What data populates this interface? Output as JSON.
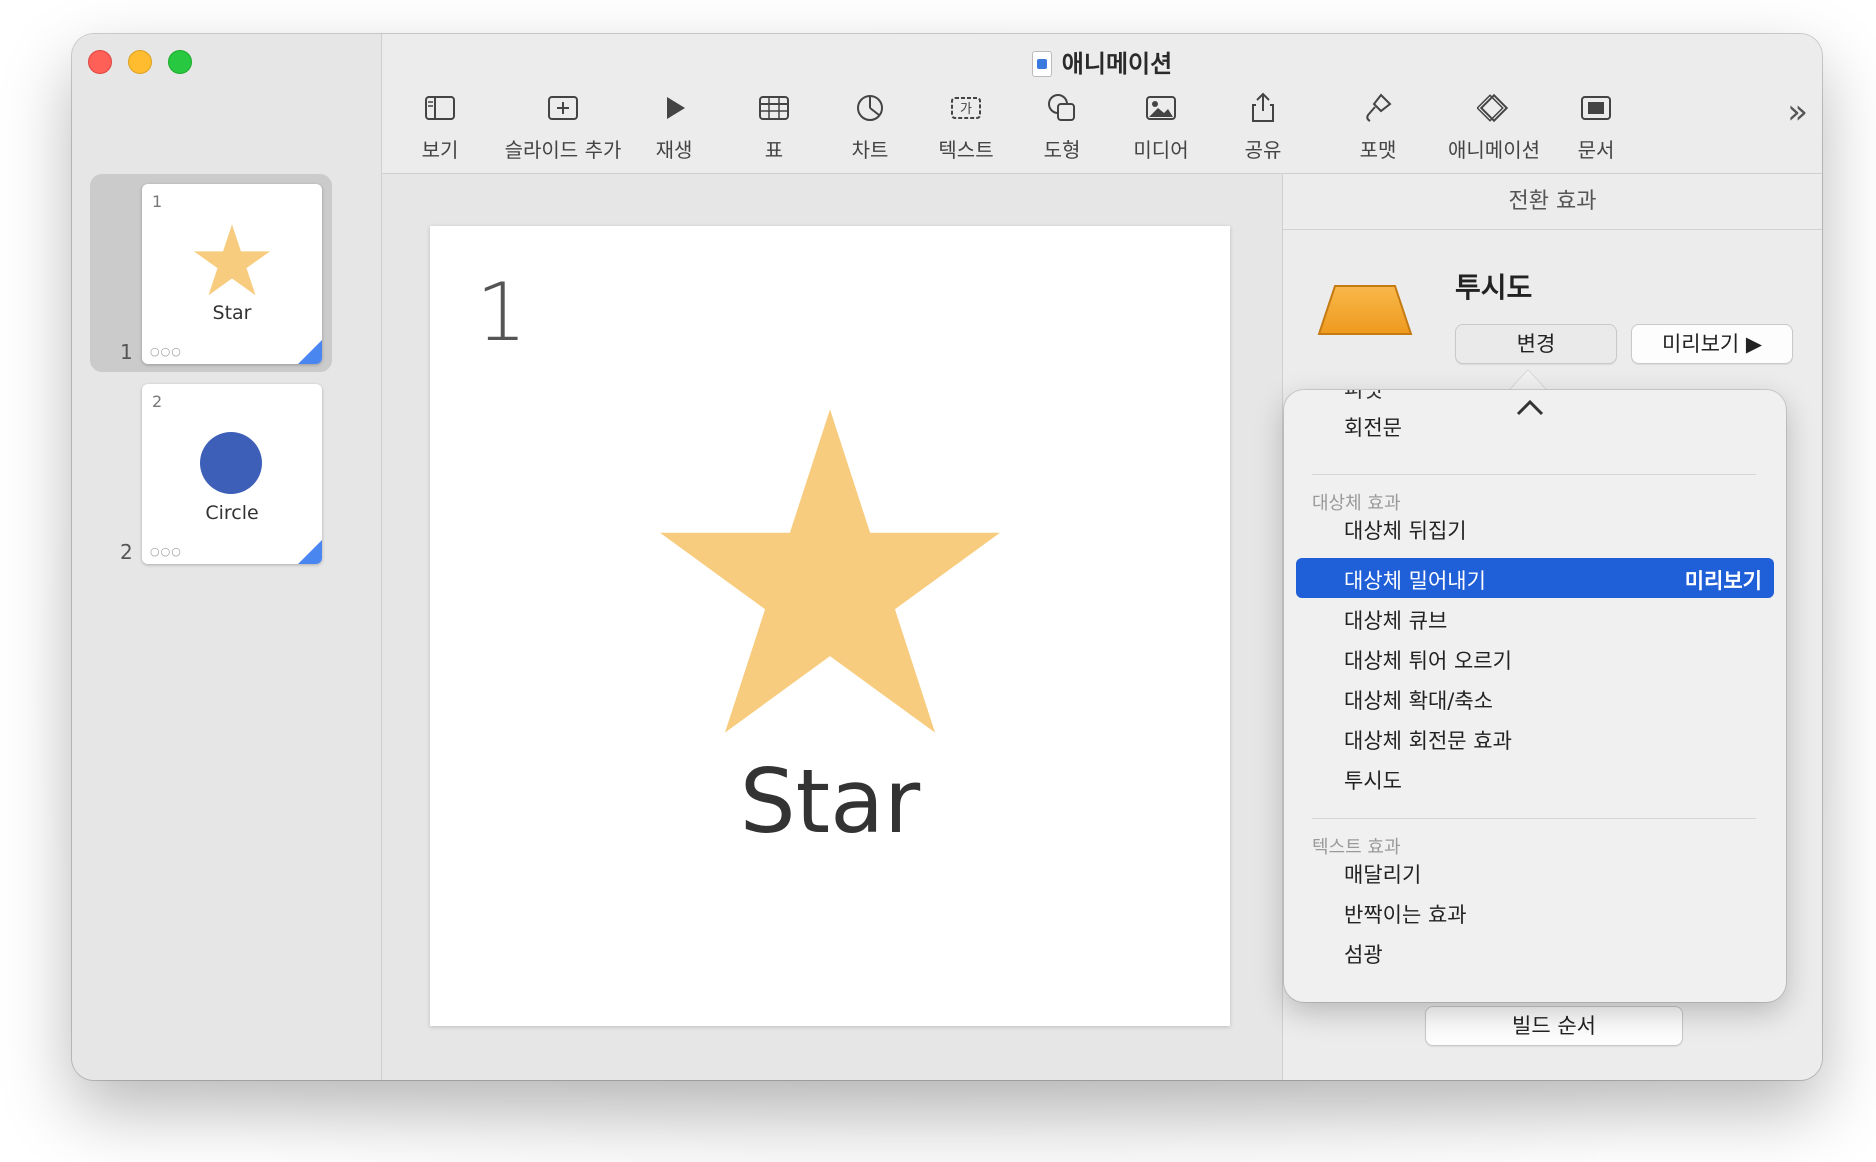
{
  "window": {
    "title": "애니메이션"
  },
  "toolbar": {
    "items": [
      {
        "label": "보기"
      },
      {
        "label": "슬라이드 추가"
      },
      {
        "label": "재생"
      },
      {
        "label": "표"
      },
      {
        "label": "차트"
      },
      {
        "label": "텍스트"
      },
      {
        "label": "도형"
      },
      {
        "label": "미디어"
      },
      {
        "label": "공유"
      },
      {
        "label": "포맷"
      },
      {
        "label": "애니메이션"
      },
      {
        "label": "문서"
      }
    ],
    "text_icon_glyph": "가",
    "more": "»"
  },
  "sidebar": {
    "slides": [
      {
        "num": "1",
        "outer_num": "1",
        "label": "Star",
        "dots": "○○○",
        "selected": true
      },
      {
        "num": "2",
        "outer_num": "2",
        "label": "Circle",
        "dots": "○○○",
        "selected": false
      }
    ]
  },
  "slide": {
    "number": "1",
    "title": "Star",
    "star_color": "#f8cc7e"
  },
  "inspector": {
    "header": "전환 효과",
    "effect_name": "투시도",
    "change_button": "변경",
    "preview_button": "미리보기 ▶",
    "build_order_button": "빌드 순서"
  },
  "popover": {
    "cut_item": "피벗",
    "items_top": [
      "회전문"
    ],
    "section_object": "대상체 효과",
    "object_items": [
      "대상체 뒤집기",
      "대상체 밀어내기",
      "대상체 큐브",
      "대상체 튀어 오르기",
      "대상체 확대/축소",
      "대상체 회전문 효과",
      "투시도"
    ],
    "highlighted_index": 1,
    "highlight_preview": "미리보기",
    "section_text": "텍스트 효과",
    "text_items": [
      "매달리기",
      "반짝이는 효과",
      "섬광"
    ],
    "accent": "#1f5fd8"
  }
}
